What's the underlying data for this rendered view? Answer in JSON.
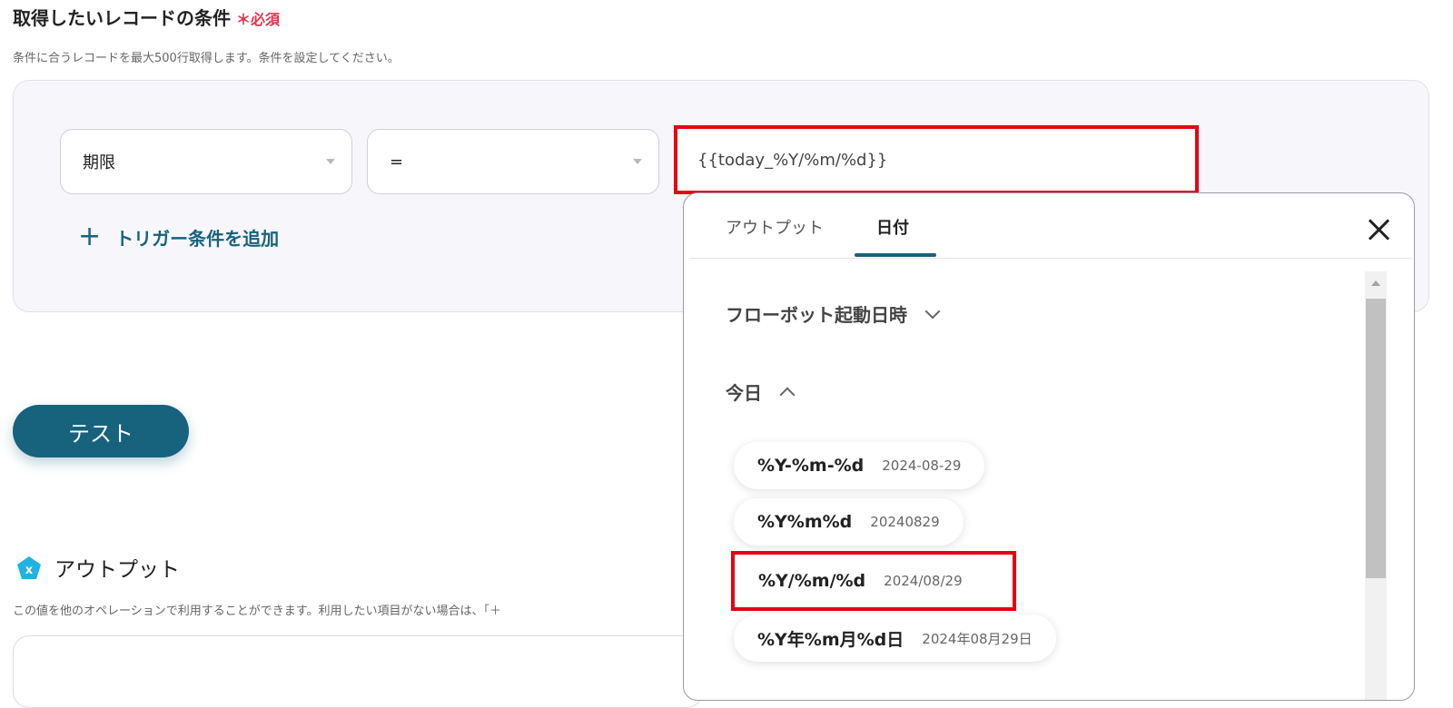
{
  "section": {
    "title": "取得したいレコードの条件",
    "required_label": "＊必須",
    "description": "条件に合うレコードを最大500行取得します。条件を設定してください。"
  },
  "condition": {
    "field_value": "期限",
    "operator_value": "=",
    "input_value": "{{today_%Y/%m/%d}}",
    "add_trigger_label": "トリガー条件を追加",
    "add_trigger_icon": "plus-icon"
  },
  "test_button": {
    "label": "テスト"
  },
  "output_section": {
    "icon": "variable-x-icon",
    "title": "アウトプット",
    "description": "この値を他のオペレーションで利用することができます。利用したい項目がない場合は、「＋"
  },
  "popup": {
    "tabs": [
      {
        "label": "アウトプット",
        "active": false
      },
      {
        "label": "日付",
        "active": true
      }
    ],
    "close_icon": "close-icon",
    "groups": [
      {
        "label": "フローボット起動日時",
        "expanded": false,
        "icon": "chevron-down-icon"
      },
      {
        "label": "今日",
        "expanded": true,
        "icon": "chevron-up-icon"
      }
    ],
    "options": [
      {
        "format": "%Y-%m-%d",
        "example": "2024-08-29"
      },
      {
        "format": "%Y%m%d",
        "example": "20240829"
      },
      {
        "format": "%Y/%m/%d",
        "example": "2024/08/29",
        "highlighted": true
      },
      {
        "format": "%Y年%m月%d日",
        "example": "2024年08月29日"
      }
    ]
  },
  "colors": {
    "accent": "#17627d",
    "highlight_border": "#e60012",
    "required": "#e0334d",
    "output_icon": "#1fb2e3"
  }
}
